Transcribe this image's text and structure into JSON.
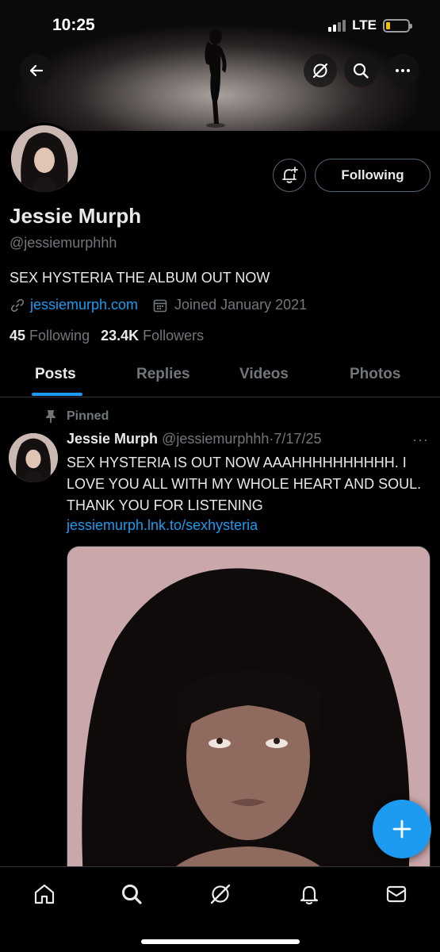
{
  "status_bar": {
    "time": "10:25",
    "network": "LTE",
    "battery_percent": 10
  },
  "header_actions": {
    "back_icon": "back-arrow-icon",
    "grok_icon": "grok-icon",
    "search_icon": "search-icon",
    "more_icon": "more-icon"
  },
  "profile": {
    "display_name": "Jessie Murph",
    "handle": "@jessiemurphhh",
    "bio": "SEX HYSTERIA THE ALBUM OUT NOW",
    "website": "jessiemurph.com",
    "joined": "Joined January 2021",
    "following_count": "45",
    "following_label": "Following",
    "followers_count": "23.4K",
    "followers_label": "Followers",
    "follow_button_label": "Following"
  },
  "tabs": [
    {
      "label": "Posts",
      "active": true
    },
    {
      "label": "Replies",
      "active": false
    },
    {
      "label": "Videos",
      "active": false
    },
    {
      "label": "Photos",
      "active": false
    }
  ],
  "pinned_post": {
    "pinned_label": "Pinned",
    "author_name": "Jessie Murph",
    "author_handle": "@jessiemurphhh",
    "separator": "·",
    "date": "7/17/25",
    "more": "···",
    "text": "SEX HYSTERIA IS OUT NOW AAAHHHHHHHHHH. I LOVE YOU ALL WITH MY WHOLE HEART AND SOUL. THANK YOU FOR LISTENING",
    "link": "jessiemurph.lnk.to/sexhysteria"
  },
  "bottom_nav": [
    "home-icon",
    "search-icon",
    "grok-icon",
    "notifications-icon",
    "messages-icon"
  ],
  "colors": {
    "accent": "#1d9bf0",
    "text_primary": "#e7e9ea",
    "text_secondary": "#71767b",
    "border": "#2f3336",
    "background": "#000000"
  }
}
